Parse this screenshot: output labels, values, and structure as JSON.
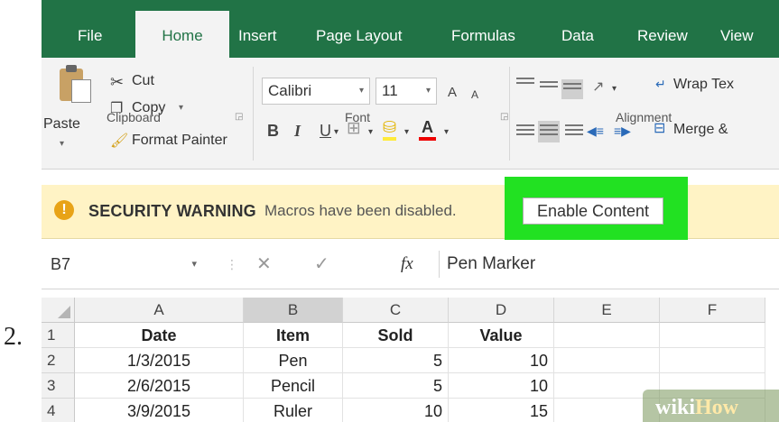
{
  "step_number": "2.",
  "ribbon_tabs": [
    "File",
    "Home",
    "Insert",
    "Page Layout",
    "Formulas",
    "Data",
    "Review",
    "View"
  ],
  "active_tab": "Home",
  "clipboard": {
    "paste": "Paste",
    "cut": "Cut",
    "copy": "Copy",
    "format_painter": "Format Painter",
    "group_label": "Clipboard"
  },
  "font_group": {
    "font_name": "Calibri",
    "font_size": "11",
    "grow": "A",
    "shrink": "A",
    "bold": "B",
    "italic": "I",
    "underline": "U",
    "font_color_letter": "A",
    "group_label": "Font"
  },
  "alignment_group": {
    "wrap_text": "Wrap Tex",
    "merge": "Merge &",
    "group_label": "Alignment"
  },
  "message_bar": {
    "title": "SECURITY WARNING",
    "text": "Macros have been disabled.",
    "button": "Enable Content"
  },
  "formula_bar": {
    "name_box": "B7",
    "fx": "fx",
    "content": "Pen Marker"
  },
  "sheet": {
    "columns": [
      "A",
      "B",
      "C",
      "D",
      "E",
      "F"
    ],
    "selected_column": "B",
    "rows": [
      {
        "num": "1",
        "cells": [
          "Date",
          "Item",
          "Sold",
          "Value",
          "",
          ""
        ]
      },
      {
        "num": "2",
        "cells": [
          "1/3/2015",
          "Pen",
          "5",
          "10",
          "",
          ""
        ]
      },
      {
        "num": "3",
        "cells": [
          "2/6/2015",
          "Pencil",
          "5",
          "10",
          "",
          ""
        ]
      },
      {
        "num": "4",
        "cells": [
          "3/9/2015",
          "Ruler",
          "10",
          "15",
          "",
          ""
        ]
      }
    ]
  },
  "watermark": {
    "part1": "wiki",
    "part2": "How"
  },
  "colors": {
    "excel_green": "#217346",
    "highlight_green": "#22e122",
    "warning_bg": "#fff3c5",
    "warning_icon": "#e8a317"
  }
}
